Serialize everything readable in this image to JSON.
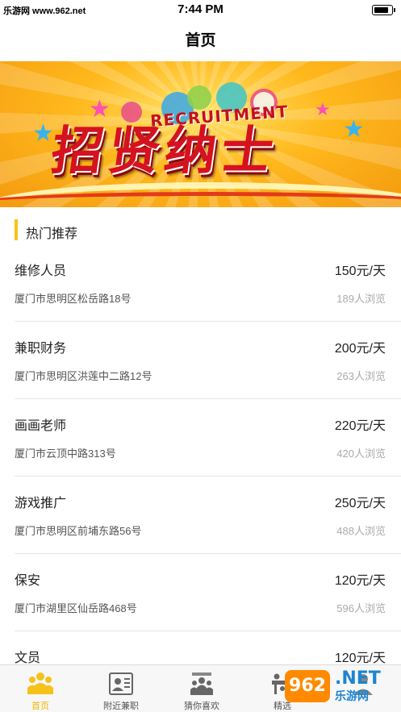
{
  "status_bar": {
    "watermark": "乐游网 www.962.net",
    "time": "7:44 PM"
  },
  "nav": {
    "title": "首页"
  },
  "banner": {
    "recruit_text": "RECRUITMENT",
    "headline": "招贤纳士"
  },
  "section": {
    "title": "热门推荐"
  },
  "jobs": [
    {
      "title": "维修人员",
      "salary": "150元/天",
      "address": "厦门市思明区松岳路18号",
      "views": "189人浏览"
    },
    {
      "title": "兼职财务",
      "salary": "200元/天",
      "address": "厦门市思明区洪莲中二路12号",
      "views": "263人浏览"
    },
    {
      "title": "画画老师",
      "salary": "220元/天",
      "address": "厦门市云顶中路313号",
      "views": "420人浏览"
    },
    {
      "title": "游戏推广",
      "salary": "250元/天",
      "address": "厦门市思明区前埔东路56号",
      "views": "488人浏览"
    },
    {
      "title": "保安",
      "salary": "120元/天",
      "address": "厦门市湖里区仙岳路468号",
      "views": "596人浏览"
    },
    {
      "title": "文员",
      "salary": "120元/天",
      "address": "",
      "views": ""
    }
  ],
  "tabs": [
    {
      "label": "首页",
      "icon": "home-people-icon",
      "active": true
    },
    {
      "label": "附近兼职",
      "icon": "id-card-icon",
      "active": false
    },
    {
      "label": "猜你喜欢",
      "icon": "group-icon",
      "active": false
    },
    {
      "label": "精选",
      "icon": "meeting-icon",
      "active": false
    },
    {
      "label": "",
      "icon": "profile-icon",
      "active": false
    }
  ],
  "watermark_logo": {
    "brand_digits": "962",
    "net": ".NET",
    "sub": "乐游网"
  },
  "colors": {
    "accent": "#f8c218",
    "active_tab": "#f2b400",
    "banner_red": "#d5121f"
  }
}
